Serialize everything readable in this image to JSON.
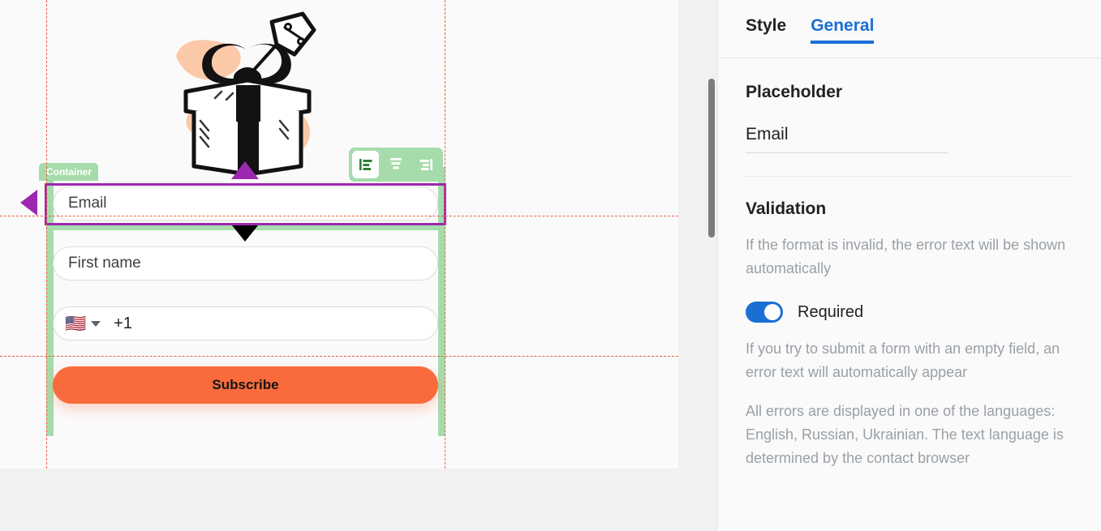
{
  "canvas": {
    "container_badge": "Container",
    "hero_image_alt": "gift-box-illustration",
    "fields": {
      "email": {
        "placeholder": "Email"
      },
      "first_name": {
        "placeholder": "First name"
      },
      "phone": {
        "flag": "🇺🇸",
        "dial_code": "+1"
      }
    },
    "submit_label": "Subscribe",
    "align_toolbar": {
      "left": "align-left",
      "center": "align-center",
      "right": "align-right",
      "active": "left"
    },
    "colors": {
      "submit_bg": "#f96b3d",
      "selection": "#9c27b0",
      "container_highlight": "#a6dcab",
      "guide": "#e8604a"
    }
  },
  "panel": {
    "tabs": [
      {
        "label": "Style",
        "active": false
      },
      {
        "label": "General",
        "active": true
      }
    ],
    "placeholder": {
      "title": "Placeholder",
      "value": "Email"
    },
    "validation": {
      "title": "Validation",
      "format_helper": "If the format is invalid, the error text will be shown automatically",
      "required_label": "Required",
      "required_on": true,
      "empty_helper": "If you try to submit a form with an empty field, an error text will automatically appear",
      "language_helper": "All errors are displayed in one of the languages: English, Russian, Ukrainian. The text language is determined by the contact browser"
    },
    "colors": {
      "accent": "#1a6fd4",
      "muted_text": "#9aa0a6"
    }
  }
}
